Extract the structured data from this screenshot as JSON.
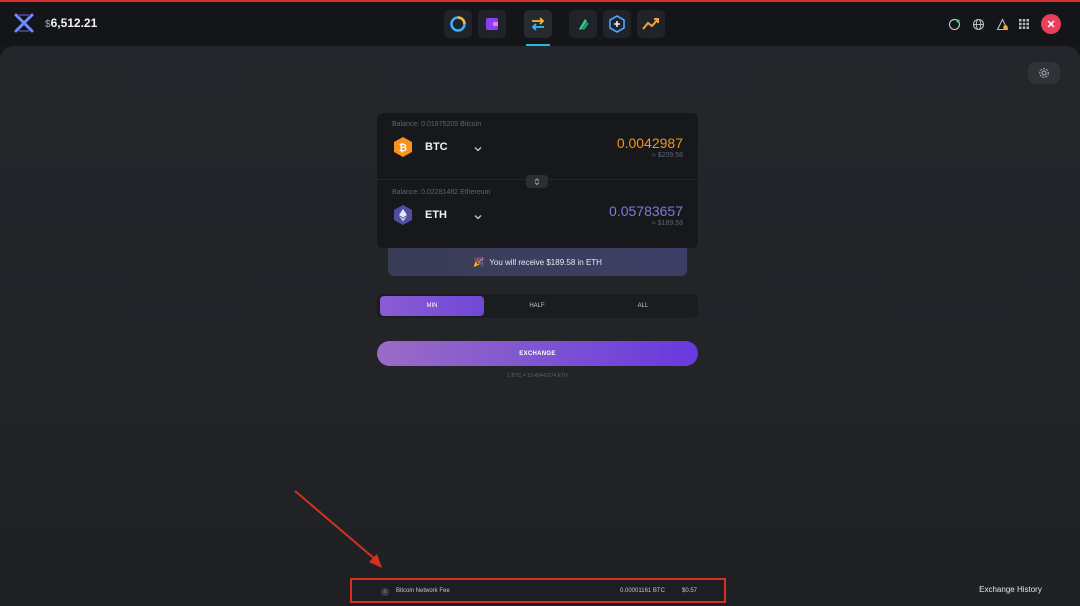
{
  "header": {
    "portfolio_currency": "$",
    "portfolio_value": "6,512.21"
  },
  "nav": {
    "icons": [
      "portfolio-icon",
      "wallet-icon",
      "exchange-icon",
      "earn-icon",
      "add-icon",
      "trade-icon"
    ],
    "active": "exchange-icon"
  },
  "exchange": {
    "from": {
      "balance": "Balance: 0.01875205 Bitcoin",
      "ticker": "BTC",
      "amount": "0.0042987",
      "usd": "≈ $209.58"
    },
    "to": {
      "balance": "Balance: 0.02281482 Ethereum",
      "ticker": "ETH",
      "amount": "0.05783657",
      "usd": "≈ $189.58"
    },
    "receive_text": "You will receive $189.58 in ETH",
    "amount_options": [
      "MIN",
      "HALF",
      "ALL"
    ],
    "selected_option": "MIN",
    "exchange_label": "EXCHANGE",
    "rate_text": "1 BTC = 13.45442274 ETH"
  },
  "fee": {
    "label": "Bitcoin Network Fee",
    "btc": "0.00001161 BTC",
    "usd": "$0.57"
  },
  "footer": {
    "history_label": "Exchange History"
  },
  "colors": {
    "accent_purple": "#7e55d0",
    "btc_orange": "#f7931a",
    "eth_purple": "#7b7be0",
    "annotation_red": "#d7301f"
  }
}
